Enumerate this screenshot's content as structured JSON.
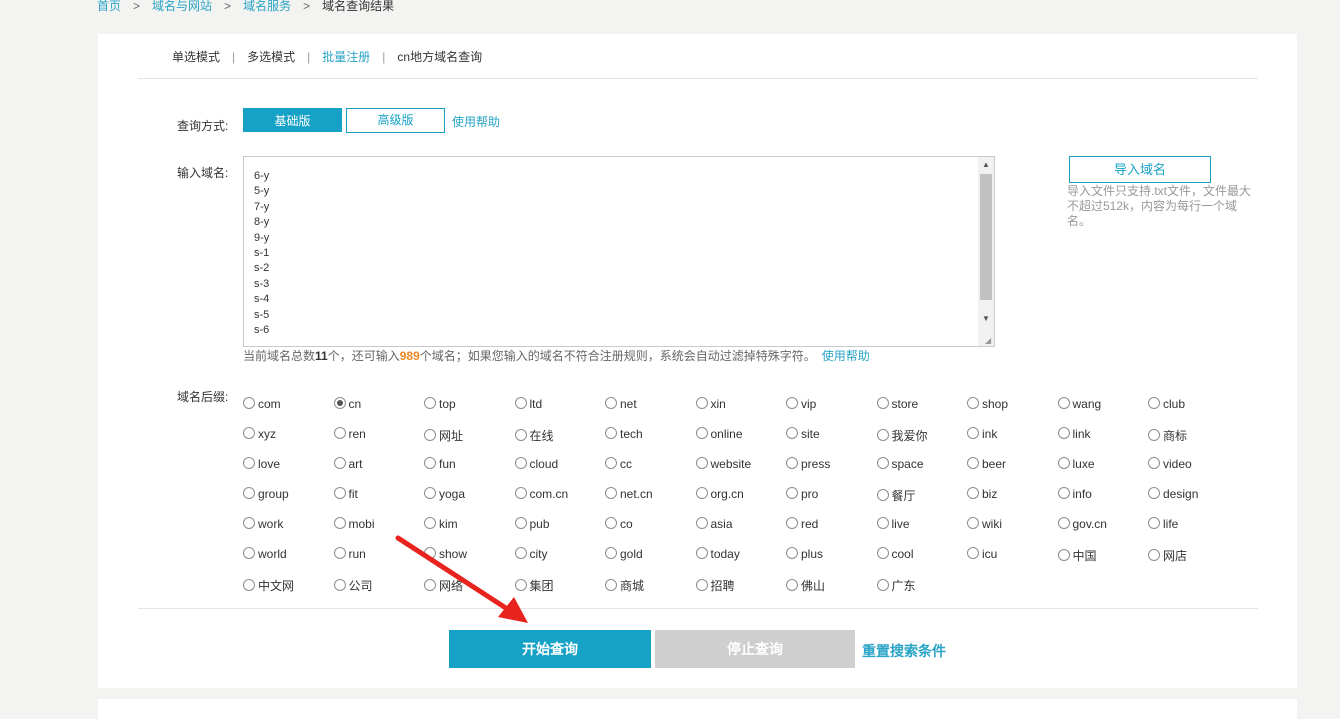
{
  "breadcrumb": {
    "home": "首页",
    "level1": "域名与网站",
    "level2": "域名服务",
    "current": "域名查询结果",
    "sep": ">"
  },
  "modes": {
    "single": "单选模式",
    "multi": "多选模式",
    "batch": "批量注册",
    "cn_local": "cn地方域名查询",
    "sep": "|"
  },
  "query_method": {
    "label": "查询方式:",
    "basic": "基础版",
    "advanced": "高级版",
    "help": "使用帮助"
  },
  "domain_input": {
    "label": "输入域名:",
    "lines": [
      "6-y",
      "5-y",
      "7-y",
      "8-y",
      "9-y",
      "s-1",
      "s-2",
      "s-3",
      "s-4",
      "s-5",
      "s-6"
    ],
    "note_prefix": "当前域名总数",
    "count": "11",
    "note_mid": "个，还可输入",
    "remaining": "989",
    "note_suffix": "个域名；如果您输入的域名不符合注册规则，系统会自动过滤掉特殊字符。",
    "help": "使用帮助"
  },
  "import": {
    "button": "导入域名",
    "note": "导入文件只支持.txt文件，文件最大不超过512k，内容为每行一个域名。"
  },
  "suffix": {
    "label": "域名后缀:",
    "selected": "cn",
    "items": [
      "com",
      "cn",
      "top",
      "ltd",
      "net",
      "xin",
      "vip",
      "store",
      "shop",
      "wang",
      "club",
      "xyz",
      "ren",
      "网址",
      "在线",
      "tech",
      "online",
      "site",
      "我爱你",
      "ink",
      "link",
      "商标",
      "love",
      "art",
      "fun",
      "cloud",
      "cc",
      "website",
      "press",
      "space",
      "beer",
      "luxe",
      "video",
      "group",
      "fit",
      "yoga",
      "com.cn",
      "net.cn",
      "org.cn",
      "pro",
      "餐厅",
      "biz",
      "info",
      "design",
      "work",
      "mobi",
      "kim",
      "pub",
      "co",
      "asia",
      "red",
      "live",
      "wiki",
      "gov.cn",
      "life",
      "world",
      "run",
      "show",
      "city",
      "gold",
      "today",
      "plus",
      "cool",
      "icu",
      "中国",
      "网店",
      "中文网",
      "公司",
      "网络",
      "集团",
      "商城",
      "招聘",
      "佛山",
      "广东"
    ]
  },
  "actions": {
    "start": "开始查询",
    "stop": "停止查询",
    "reset": "重置搜索条件"
  },
  "colors": {
    "accent": "#16a2c6",
    "link": "#2aa4c6",
    "highlight": "#f08a24",
    "disabled": "#cfcfcf",
    "annotation_arrow": "#e8231e"
  }
}
